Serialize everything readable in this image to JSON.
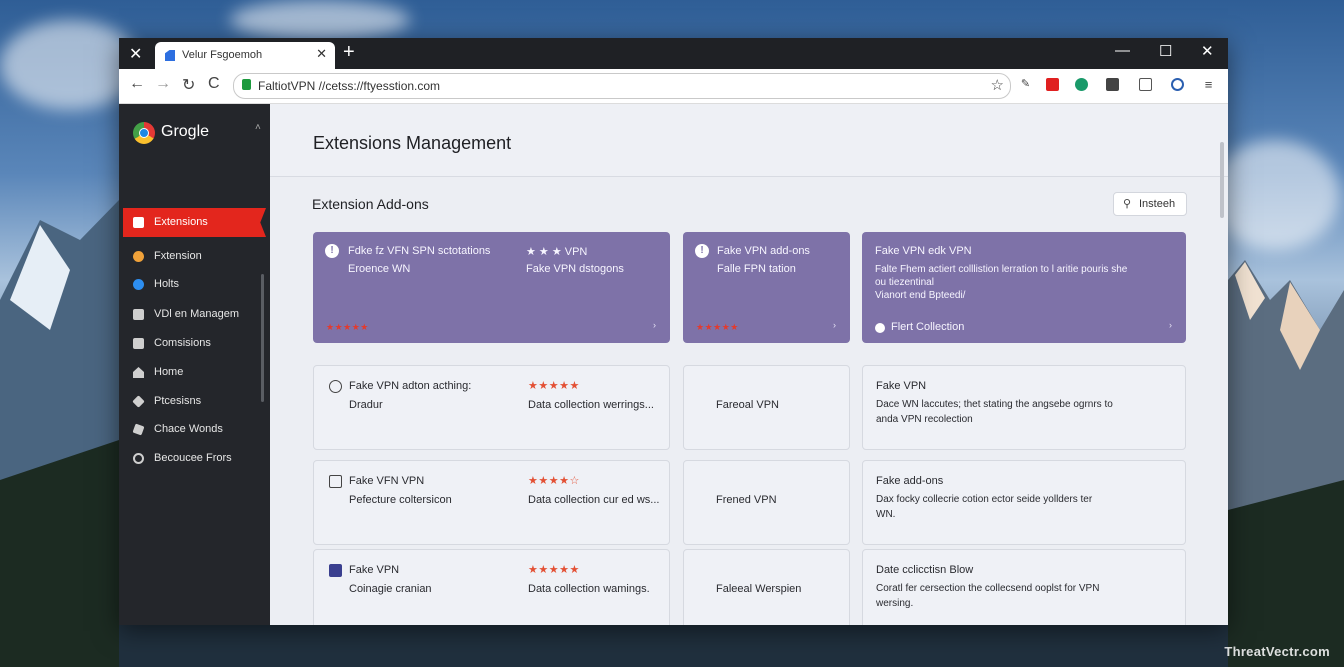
{
  "desktop": {
    "watermark": "ThreatVectr.com"
  },
  "browser": {
    "close_label": "✕",
    "tab_title": "Velur Fsgoemoh",
    "tab_close": "✕",
    "new_tab": "+",
    "win_minimize": "—",
    "win_maximize": "☐",
    "win_close": "✕",
    "nav_back": "←",
    "nav_forward": "→",
    "nav_reload": "↻",
    "nav_refresh": "C",
    "url": "FaltiotVPN //cetss://ftyesstion.com",
    "bookmark_icon": "☆",
    "extensions_icons": [
      "puzzle-icon",
      "red-shield-icon",
      "green-addon-icon",
      "media-icon",
      "clipboard-icon",
      "profile-icon",
      "menu-icon"
    ]
  },
  "sidebar": {
    "logo_text": "Grogle",
    "logo_caret": "˄",
    "active_item": {
      "label": "Extensions",
      "icon": "extensions-icon"
    },
    "items": [
      {
        "label": "Fxtension",
        "icon": "extension-icon",
        "color": "#f0a23a"
      },
      {
        "label": "Holts",
        "icon": "globe-icon",
        "color": "#2d8ef0"
      },
      {
        "label": "VDl en Managem",
        "icon": "manager-icon",
        "color": "#cfcfcf"
      },
      {
        "label": "Comsisions",
        "icon": "document-icon",
        "color": "#cfcfcf"
      },
      {
        "label": "Home",
        "icon": "home-icon",
        "color": "#cfcfcf"
      },
      {
        "label": "Ptcesisns",
        "icon": "tools-icon",
        "color": "#cfcfcf"
      },
      {
        "label": "Chace Wonds",
        "icon": "settings-icon",
        "color": "#cfcfcf"
      },
      {
        "label": "Becoucee Frors",
        "icon": "circle-icon",
        "color": "#cfcfcf"
      }
    ]
  },
  "main": {
    "title": "Extensions Management",
    "section_title": "Extension Add-ons",
    "install_button": {
      "icon": "search-icon",
      "label": "Insteeh"
    },
    "featured_cards": [
      {
        "left_title": "Fdke fz VFN SPN sctotations",
        "left_sub": "Eroence WN",
        "right_title": "★ ★ ★ VPN",
        "right_sub": "Fake VPN dstogons",
        "rating": "★★★★★",
        "end": "›"
      },
      {
        "title": "Fake VPN add-ons",
        "sub": "Falle FPN tation",
        "rating": "★★★★★",
        "end": "›"
      },
      {
        "title": "Fake VPN edk VPN",
        "desc1": "Falte Fhem actiert colllistion lerration to l aritie pouris she",
        "desc2": "ou tiezentinal",
        "desc3": "Vianort end Bpteedi/",
        "footer": "Flert Collection",
        "end": "›"
      }
    ],
    "rows": [
      {
        "icon": "alert-icon",
        "left_title": "Fake VPN adton acthing:",
        "left_sub": "Dradur",
        "rating": "★★★★★",
        "rating_note": "Data collection werrings...",
        "middle": "Fareoal VPN",
        "right_title": "Fake VPN",
        "right_desc1": "Dace WN laccutes; thet stating the angsebe ogrnrs to",
        "right_desc2": "anda VPN recolection"
      },
      {
        "icon": "window-icon",
        "left_title": "Fake VFN VPN",
        "left_sub": "Pefecture coltersicon",
        "rating": "★★★★☆",
        "rating_note": "Data collection cur ed ws...",
        "middle": "Frened VPN",
        "right_title": "Fake add-ons",
        "right_desc1": "Dax focky collecrie cotion ector seide yollders ter",
        "right_desc2": "WN."
      },
      {
        "icon": "app-icon",
        "left_title": "Fake VPN",
        "left_sub": "Coinagie cranian",
        "rating": "★★★★★",
        "rating_note": "Data collection wamings.",
        "middle": "Faleeal Werspien",
        "right_title": "Date cclicctisn Blow",
        "right_desc1": "Coratl fer cersection the collecsend ooplst for VPN",
        "right_desc2": "wersing."
      }
    ]
  }
}
